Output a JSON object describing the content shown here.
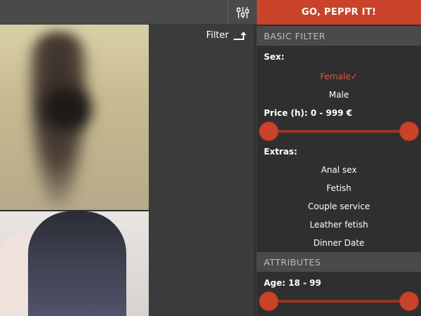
{
  "header": {
    "go_button_label": "GO, PEPPR IT!",
    "filter_toggle_icon": "sliders-icon"
  },
  "middle": {
    "filter_label": "Filter",
    "filter_icon": "return-arrow-icon"
  },
  "panel": {
    "basic_filter": {
      "heading": "BASIC FILTER",
      "sex_label": "Sex:",
      "sex_options": [
        {
          "label": "Female",
          "selected": true,
          "check": "✓"
        },
        {
          "label": "Male",
          "selected": false
        }
      ],
      "price_label": "Price (h): 0 - 999 €",
      "price_range": {
        "min": 0,
        "max": 999,
        "low": 0,
        "high": 999
      },
      "extras_label": "Extras:",
      "extras": [
        "Anal sex",
        "Fetish",
        "Couple service",
        "Leather fetish",
        "Dinner Date"
      ]
    },
    "attributes": {
      "heading": "ATTRIBUTES",
      "age_label": "Age: 18 - 99",
      "age_range": {
        "min": 18,
        "max": 99,
        "low": 18,
        "high": 99
      }
    }
  },
  "colors": {
    "accent": "#c8432a",
    "selected_text": "#d9583f",
    "panel_bg": "#2f2f2f",
    "section_bg": "#4a4a4a"
  }
}
